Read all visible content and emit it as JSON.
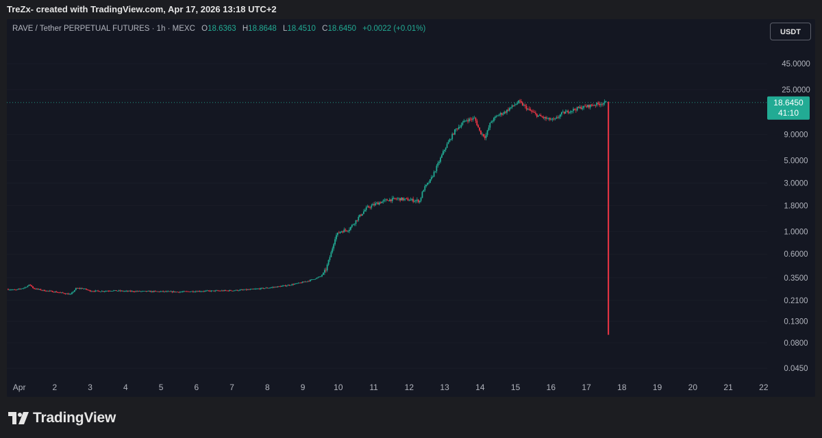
{
  "header": {
    "caption": "TreZx- created with TradingView.com, Apr 17, 2026 13:18 UTC+2"
  },
  "legend": {
    "symbol": "RAVE / Tether PERPETUAL FUTURES · 1h · MEXC",
    "o_label": "O",
    "o_value": "18.6363",
    "h_label": "H",
    "h_value": "18.8648",
    "l_label": "L",
    "l_value": "18.4510",
    "c_label": "C",
    "c_value": "18.6450",
    "change": "+0.0022 (+0.01%)"
  },
  "currency": "USDT",
  "price_tag": {
    "price": "18.6450",
    "countdown": "41:10"
  },
  "footer": {
    "brand": "TradingView"
  },
  "colors": {
    "up": "#22ab94",
    "down": "#f23645",
    "background": "#141722",
    "axis_text": "#b2b5be",
    "grid": "#363a45"
  },
  "chart_data": {
    "type": "candlestick",
    "title": "RAVE / Tether PERPETUAL FUTURES · 1h · MEXC",
    "y_scale": "log",
    "ylim": [
      0.032,
      80
    ],
    "y_ticks": [
      "45.0000",
      "25.0000",
      "9.0000",
      "5.0000",
      "3.0000",
      "1.8000",
      "1.0000",
      "0.6000",
      "0.3500",
      "0.2100",
      "0.1300",
      "0.0800",
      "0.0450"
    ],
    "x_range": [
      0.65,
      22.1
    ],
    "x_ticks": [
      {
        "day": 1,
        "label": "Apr"
      },
      {
        "day": 2,
        "label": "2"
      },
      {
        "day": 3,
        "label": "3"
      },
      {
        "day": 4,
        "label": "4"
      },
      {
        "day": 5,
        "label": "5"
      },
      {
        "day": 6,
        "label": "6"
      },
      {
        "day": 7,
        "label": "7"
      },
      {
        "day": 8,
        "label": "8"
      },
      {
        "day": 9,
        "label": "9"
      },
      {
        "day": 10,
        "label": "10"
      },
      {
        "day": 11,
        "label": "11"
      },
      {
        "day": 12,
        "label": "12"
      },
      {
        "day": 13,
        "label": "13"
      },
      {
        "day": 14,
        "label": "14"
      },
      {
        "day": 15,
        "label": "15"
      },
      {
        "day": 16,
        "label": "16"
      },
      {
        "day": 17,
        "label": "17"
      },
      {
        "day": 18,
        "label": "18"
      },
      {
        "day": 19,
        "label": "19"
      },
      {
        "day": 20,
        "label": "20"
      },
      {
        "day": 21,
        "label": "21"
      },
      {
        "day": 22,
        "label": "22"
      }
    ],
    "price_path": [
      [
        0.65,
        0.27
      ],
      [
        0.9,
        0.265
      ],
      [
        1.15,
        0.28
      ],
      [
        1.3,
        0.3
      ],
      [
        1.4,
        0.275
      ],
      [
        1.7,
        0.262
      ],
      [
        2.0,
        0.255
      ],
      [
        2.3,
        0.245
      ],
      [
        2.45,
        0.24
      ],
      [
        2.6,
        0.275
      ],
      [
        2.8,
        0.275
      ],
      [
        3.0,
        0.26
      ],
      [
        3.3,
        0.258
      ],
      [
        3.6,
        0.262
      ],
      [
        4.0,
        0.258
      ],
      [
        4.5,
        0.257
      ],
      [
        5.0,
        0.256
      ],
      [
        5.5,
        0.254
      ],
      [
        6.0,
        0.258
      ],
      [
        6.5,
        0.26
      ],
      [
        7.0,
        0.262
      ],
      [
        7.5,
        0.268
      ],
      [
        8.0,
        0.278
      ],
      [
        8.5,
        0.292
      ],
      [
        8.9,
        0.31
      ],
      [
        9.2,
        0.33
      ],
      [
        9.5,
        0.36
      ],
      [
        9.65,
        0.42
      ],
      [
        9.8,
        0.62
      ],
      [
        9.92,
        0.9
      ],
      [
        10.05,
        1.0
      ],
      [
        10.3,
        1.05
      ],
      [
        10.55,
        1.35
      ],
      [
        10.8,
        1.7
      ],
      [
        11.1,
        1.9
      ],
      [
        11.4,
        2.05
      ],
      [
        11.7,
        2.1
      ],
      [
        12.0,
        2.05
      ],
      [
        12.3,
        2.0
      ],
      [
        12.4,
        2.6
      ],
      [
        12.6,
        3.2
      ],
      [
        12.8,
        4.5
      ],
      [
        13.0,
        6.5
      ],
      [
        13.3,
        10.0
      ],
      [
        13.6,
        12.5
      ],
      [
        13.85,
        13.0
      ],
      [
        14.0,
        9.5
      ],
      [
        14.15,
        8.5
      ],
      [
        14.3,
        12.0
      ],
      [
        14.5,
        14.0
      ],
      [
        14.7,
        15.0
      ],
      [
        14.85,
        16.5
      ],
      [
        15.1,
        19.0
      ],
      [
        15.35,
        16.0
      ],
      [
        15.6,
        14.0
      ],
      [
        15.9,
        12.8
      ],
      [
        16.1,
        12.5
      ],
      [
        16.3,
        14.5
      ],
      [
        16.55,
        15.5
      ],
      [
        16.8,
        16.5
      ],
      [
        17.05,
        17.2
      ],
      [
        17.3,
        18.0
      ],
      [
        17.55,
        18.6
      ]
    ],
    "last_price": 18.645,
    "last_x": 17.55,
    "dip_low": 0.096,
    "dip_x": 17.62
  }
}
